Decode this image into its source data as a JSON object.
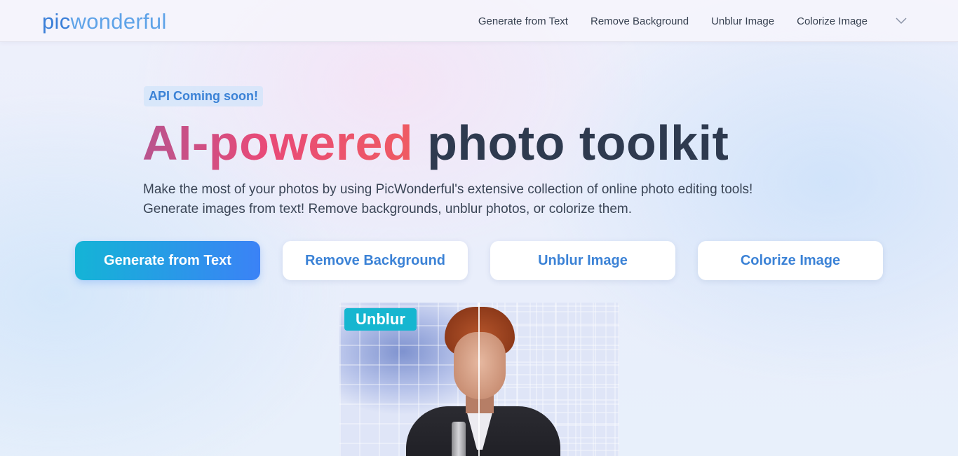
{
  "nav": {
    "logo_part1": "pic",
    "logo_part2": "wonderful",
    "links": [
      "Generate from Text",
      "Remove Background",
      "Unblur Image",
      "Colorize Image"
    ],
    "more_icon": "chevron-down-icon"
  },
  "hero": {
    "badge": "API Coming soon!",
    "headline_accent": "AI-powered",
    "headline_rest": "photo toolkit",
    "subtitle_line1": "Make the most of your photos by using PicWonderful's extensive collection of online photo editing tools!",
    "subtitle_line2": "Generate images from text! Remove backgrounds, unblur photos, or colorize them."
  },
  "tools": {
    "buttons": [
      {
        "label": "Generate from Text",
        "active": true
      },
      {
        "label": "Remove Background",
        "active": false
      },
      {
        "label": "Unblur Image",
        "active": false
      },
      {
        "label": "Colorize Image",
        "active": false
      }
    ]
  },
  "demo": {
    "label": "Unblur"
  },
  "colors": {
    "brand_blue": "#3b82d6",
    "accent_pink": "#e84a78",
    "primary_gradient_start": "#14b4d6",
    "primary_gradient_end": "#3b82f6",
    "heading_dark": "#2e3a4f"
  }
}
